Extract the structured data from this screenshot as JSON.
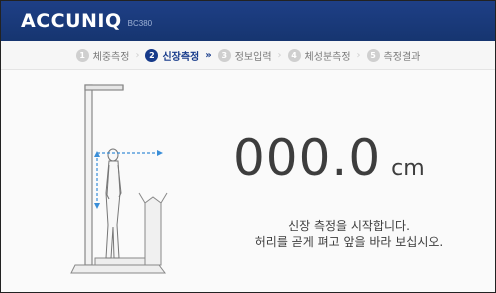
{
  "header": {
    "brand": "ACCUNIQ",
    "model": "BC380"
  },
  "steps": [
    {
      "number": "1",
      "label": "체중측정",
      "state": "done"
    },
    {
      "number": "2",
      "label": "신장측정",
      "state": "active"
    },
    {
      "number": "3",
      "label": "정보입력",
      "state": "pending"
    },
    {
      "number": "4",
      "label": "체성분측정",
      "state": "pending"
    },
    {
      "number": "5",
      "label": "측정결과",
      "state": "pending"
    }
  ],
  "measurement": {
    "value": "000.0",
    "unit": "cm"
  },
  "message": {
    "line1": "신장 측정을 시작합니다.",
    "line2": "허리를 곧게 펴고 앞을 바라 보십시오."
  },
  "colors": {
    "header": "#1e3f86",
    "active_step": "#163a8a",
    "arrow": "#3a8ed8",
    "text": "#3d3d3d"
  }
}
